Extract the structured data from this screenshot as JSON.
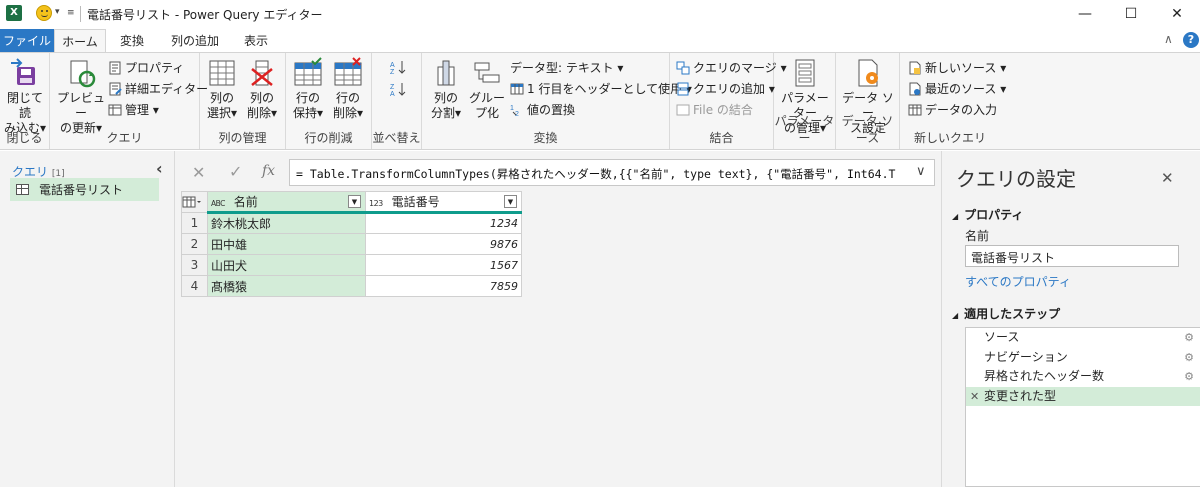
{
  "titlebar": {
    "title": "電話番号リスト - Power Query エディター",
    "qat_dropdown": "▾",
    "min_label": "—",
    "max_label": "☐",
    "close_label": "✕"
  },
  "tabs": {
    "file": "ファイル",
    "home": "ホーム",
    "transform": "変換",
    "add_column": "列の追加",
    "view": "表示",
    "collapse": "∧",
    "help": "?"
  },
  "ribbon": {
    "close_group": {
      "label": "閉じる",
      "close_load_1": "閉じて読",
      "close_load_2": "み込む▾"
    },
    "query_group": {
      "label": "クエリ",
      "preview_1": "プレビュー",
      "preview_2": "の更新▾",
      "properties": "プロパティ",
      "advanced_editor": "詳細エディター",
      "manage": "管理 ▾"
    },
    "cols_group": {
      "label": "列の管理",
      "choose_1": "列の",
      "choose_2": "選択▾",
      "remove_1": "列の",
      "remove_2": "削除▾"
    },
    "rows_group": {
      "label": "行の削減",
      "keep_1": "行の",
      "keep_2": "保持▾",
      "remove_1": "行の",
      "remove_2": "削除▾"
    },
    "sort_group": {
      "label": "並べ替え"
    },
    "transform_group": {
      "label": "変換",
      "split_1": "列の",
      "split_2": "分割▾",
      "group_1": "グルー",
      "group_2": "プ化",
      "datatype": "データ型: テキスト ▾",
      "first_row": "1 行目をヘッダーとして使用 ▾",
      "replace": "値の置換"
    },
    "combine_group": {
      "label": "結合",
      "merge": "クエリのマージ ▾",
      "append": "クエリの追加 ▾",
      "combine_files": "File の結合"
    },
    "params_group": {
      "label": "パラメーター",
      "manage_1": "パラメーター",
      "manage_2": "の管理▾"
    },
    "datasource_group": {
      "label": "データ ソース",
      "settings_1": "データ ソー",
      "settings_2": "ス設定"
    },
    "newquery_group": {
      "label": "新しいクエリ",
      "new_source": "新しいソース ▾",
      "recent": "最近のソース ▾",
      "enter_data": "データの入力"
    }
  },
  "left_pane": {
    "header": "クエリ",
    "count": "[1]",
    "collapse": "‹",
    "queries": [
      {
        "label": "電話番号リスト"
      }
    ]
  },
  "formula_bar": {
    "cancel": "✕",
    "commit": "✓",
    "fx": "fx",
    "formula": "= Table.TransformColumnTypes(昇格されたヘッダー数,{{\"名前\", type text}, {\"電話番号\", Int64.Type}",
    "expand": "∨"
  },
  "grid": {
    "columns": [
      {
        "type_icon": "ABC",
        "name": "名前"
      },
      {
        "type_icon": "123",
        "name": "電話番号"
      }
    ],
    "rows": [
      {
        "num": "1",
        "name": "鈴木桃太郎",
        "phone": "1234"
      },
      {
        "num": "2",
        "name": "田中雄",
        "phone": "9876"
      },
      {
        "num": "3",
        "name": "山田犬",
        "phone": "1567"
      },
      {
        "num": "4",
        "name": "髙橋猿",
        "phone": "7859"
      }
    ]
  },
  "settings": {
    "title": "クエリの設定",
    "close": "✕",
    "properties_header": "プロパティ",
    "name_label": "名前",
    "name_value": "電話番号リスト",
    "all_properties": "すべてのプロパティ",
    "steps_header": "適用したステップ",
    "steps": [
      {
        "label": "ソース",
        "has_gear": true
      },
      {
        "label": "ナビゲーション",
        "has_gear": true
      },
      {
        "label": "昇格されたヘッダー数",
        "has_gear": true
      },
      {
        "label": "変更された型",
        "has_gear": false,
        "selected": true
      }
    ]
  },
  "colors": {
    "accent": "#2b78c5",
    "selected": "#d3ecd8",
    "header_col": "#d3ecd8",
    "teal": "#0f9c8c"
  }
}
